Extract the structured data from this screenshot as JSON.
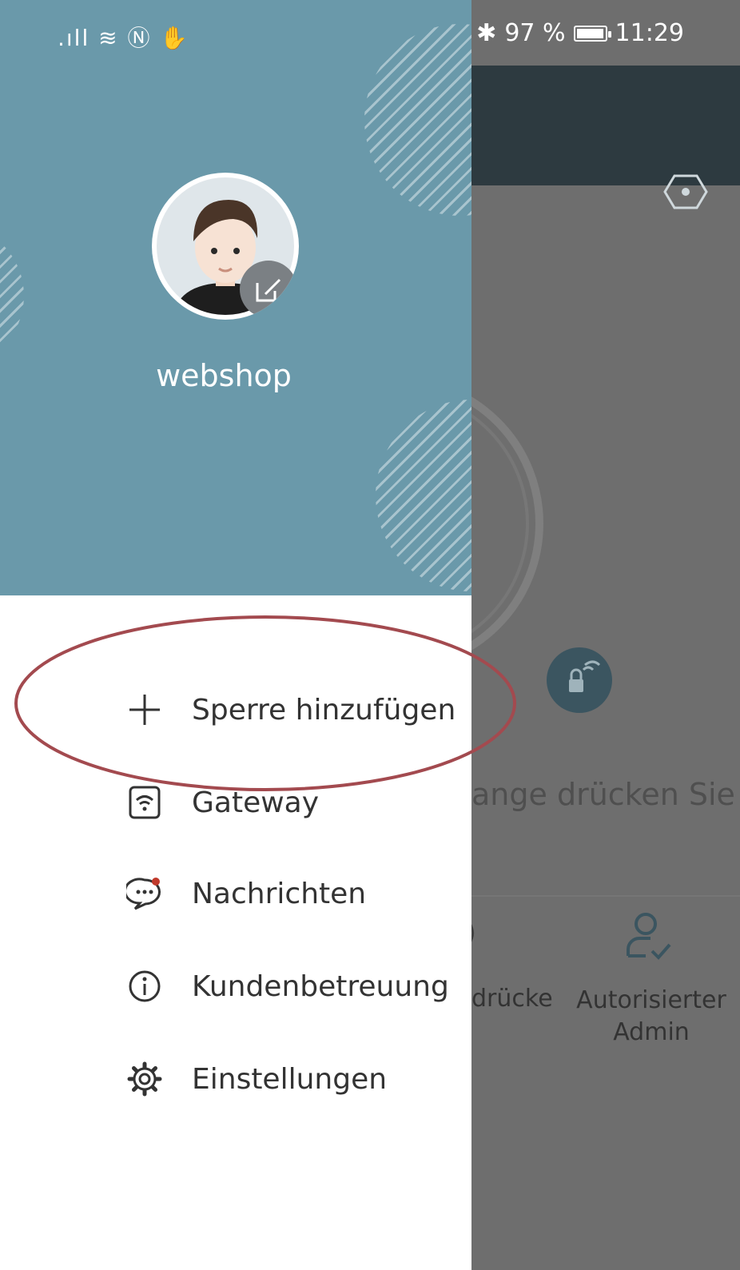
{
  "status_bar": {
    "left_icons": ".ıll ≋ Ⓝ ✋",
    "battery": "97 %",
    "time": "11:29",
    "battery_level": 0.97
  },
  "drawer": {
    "username": "webshop",
    "menu": [
      {
        "label": "Sperre hinzufügen",
        "icon": "plus-icon"
      },
      {
        "label": "Gateway",
        "icon": "wifi-box-icon"
      },
      {
        "label": "Nachrichten",
        "icon": "chat-bubble-icon"
      },
      {
        "label": "Kundenbetreuung",
        "icon": "info-icon"
      },
      {
        "label": "Einstellungen",
        "icon": "gear-icon"
      }
    ]
  },
  "background_app": {
    "hint_text": "ange drücken Sie",
    "bottom_left_label": "drücke",
    "bottom_right_label": "Autorisierter Admin"
  },
  "colors": {
    "drawer_header": "#6a99aa",
    "bg_topbar": "#2d3a40",
    "overlay": "#6e6e6e",
    "highlight": "#a34a4f"
  }
}
